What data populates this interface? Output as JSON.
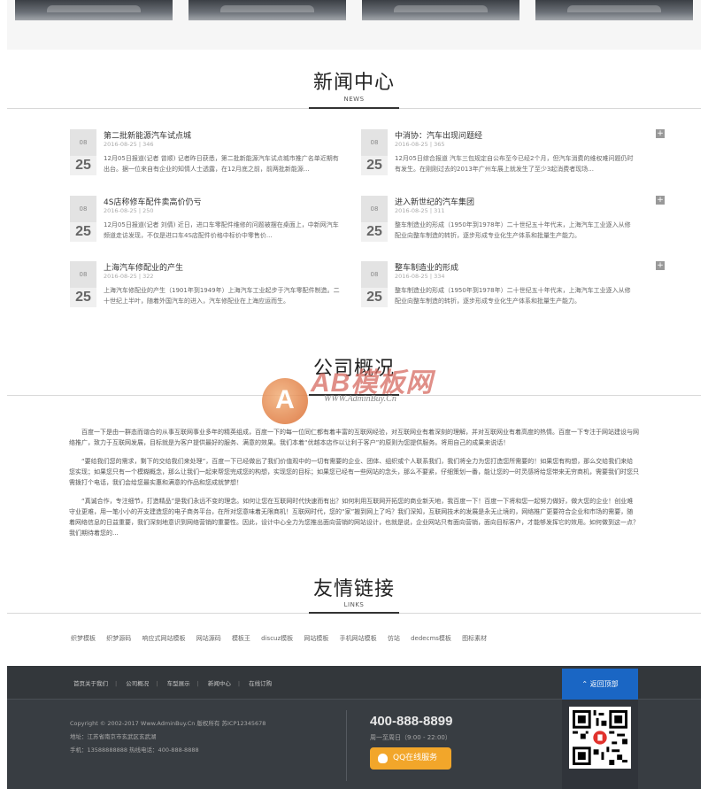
{
  "news_section": {
    "title": "新闻中心",
    "subtitle": "NEWS",
    "items": [
      {
        "month": "08",
        "day": "25",
        "title": "第二批新能源汽车试点城",
        "meta": "2016-08-25 | 346",
        "desc": "12月05日报道(记者 曾顺) 记者昨日获悉，第二批新能源汽车试点城市推广名单近期有出台。据一位来自有企业的知情人士透露，在12月底之前，前两批新能源..."
      },
      {
        "month": "08",
        "day": "25",
        "title": "中消协：汽车出现问题经",
        "meta": "2016-08-25 | 365",
        "desc": "12月05日综合报道 汽车三包规定自公布至今已经2个月，但汽车消费的维权难问题仍时有发生。在刚刚过去的2013年广州车展上就发生了至少3起消费者现场..."
      },
      {
        "month": "08",
        "day": "25",
        "title": "4S店称修车配件卖高价仍亏",
        "meta": "2016-08-25 | 250",
        "desc": "12月05日报道(记者 刘倩) 近日，进口车零配件维修的问题被摆在桌面上，中新网汽车频道走访发现，不仅是进口车4S店配件价格中标价中零售价..."
      },
      {
        "month": "08",
        "day": "25",
        "title": "进入新世纪的汽车集团",
        "meta": "2016-08-25 | 311",
        "desc": "整车制造业的形成（1950年到1978年）二十世纪五十年代末，上海汽车工业逐入从修配业向整车制造的转折，逐步形成专业化生产体系和批量生产能力。"
      },
      {
        "month": "08",
        "day": "25",
        "title": "上海汽车修配业的产生",
        "meta": "2016-08-25 | 322",
        "desc": "上海汽车修配业的产生（1901年到1949年）上海汽车工业起步于汽车零配件制造。二十世纪上半叶，随着外国汽车的进入，汽车修配业在上海应运而生。"
      },
      {
        "month": "08",
        "day": "25",
        "title": "整车制造业的形成",
        "meta": "2016-08-25 | 334",
        "desc": "整车制造业的形成（1950年到1978年）二十世纪五十年代末，上海汽车工业逐入从修配业向整车制造的转折，逐步形成专业化生产体系和批量生产能力。"
      }
    ]
  },
  "overview_section": {
    "title": "公司概况",
    "paragraphs": [
      "百度一下是由一群态而谐合的从事互联网事业多年的精英组成，百度一下的每一位同仁都有着丰富的互联网经验，对互联网业有着深刻的理解，并对互联网业有着高度的热情。百度一下专注于网站建设与网络推广，致力于互联网发展，目标就是为客户提供最好的服务、满意的效果。我们本着“优越本店作以让利于客户”的原则为您提供服务。将用自己的成果来说话！",
      "“要给我们您的需求，剩下的交给我们来处理”，百度一下已经做出了我们价值观中的一切有需要的企业、团体、组织或个人联系我们，我们将全力为您打造您所需要的！如果您有构想，那么交给我们来给您实现；如果您只有一个模糊概念，那么让我们一起来帮您完成您的构想，实现您的目标；如果您已经有一些网站的念头，那么不要紧，仔细策划一番，能让您的一时灵感将给您带来无穷商机，需要我们时您只需拨打个电话，我们会给您最实惠和满意的作品和您成就梦想！",
      "“真诚合作，专注细节，打造精品”是我们永远不变的理念。如何让您在互联网时代快速而有出？如何利用互联网开拓您的商业新天地，我百度一下！百度一下将和您一起努力做好，做大您的企业！创业难守业更难，用一笔小小的开支建造您的电子商务平台，在所对您意味着无限商机！互联网时代，您的“家”搬到网上了吗？我们深知，互联网技术的发展是永无止境的，网络推广更要符合企业和市场的需要，随着网络信息的日益重要，我们深刻地意识到网络营销的重要性。因此，设计中心全力为您推出面向营销的网站设计，也就是说，企业网站只有面向营销，面向目标客户，才能够发挥它的效用。如何做到这一点？我们期待着您的..."
    ]
  },
  "watermark": {
    "logo_letter": "A",
    "brand": "AB模板网",
    "url": "WWW.AdminBuy.Cn"
  },
  "links_section": {
    "title": "友情链接",
    "subtitle": "LINKS",
    "links": [
      "织梦模板",
      "织梦源码",
      "响应式网站模板",
      "网站源码",
      "模板王",
      "discuz模板",
      "网站模板",
      "手机网站模板",
      "仿站",
      "dedecms模板",
      "图标素材"
    ]
  },
  "footer": {
    "nav": [
      "首页关于我们",
      "公司概况",
      "车型展示",
      "新闻中心",
      "在线订购"
    ],
    "back_top": "返回顶部",
    "copyright": "Copyright © 2002-2017 Www.AdminBuy.Cn 版权所有 苏ICP12345678",
    "address": "地址：江苏省南京市玄武区玄武湖",
    "contact": "手机：13588888888 热线电话：400-888-8888",
    "phone": "400-888-8899",
    "hours": "周一至周日（9:00 - 22:00）",
    "qq_label": "QQ在线服务"
  }
}
